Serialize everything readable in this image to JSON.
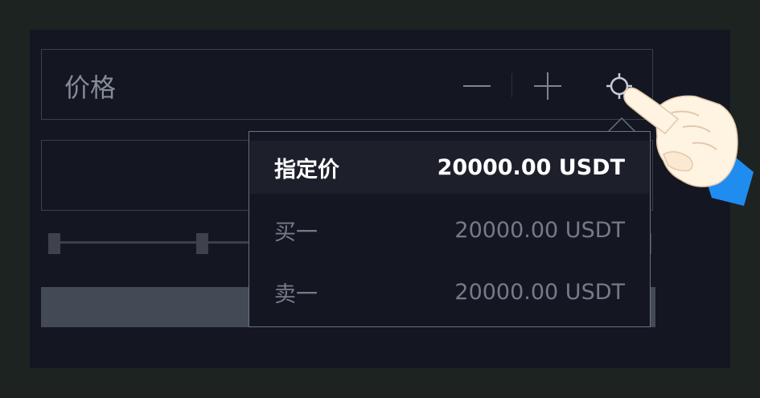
{
  "price_field": {
    "label": "价格",
    "minus_symbol": "—",
    "plus_symbol": "+"
  },
  "price_menu": {
    "options": [
      {
        "label": "指定价",
        "value": "20000.00 USDT",
        "selected": true
      },
      {
        "label": "买一",
        "value": "20000.00 USDT",
        "selected": false
      },
      {
        "label": "卖一",
        "value": "20000.00 USDT",
        "selected": false
      }
    ]
  },
  "colors": {
    "background": "#141721",
    "border": "#3b404c",
    "selected_text": "#ffffff",
    "muted_text": "#757b88",
    "cursor_cuff": "#1f8cf0",
    "cursor_skin": "#fff3e2"
  },
  "icons": {
    "price_selector": "crosshair-target-icon",
    "pointer": "pointing-hand-icon"
  }
}
